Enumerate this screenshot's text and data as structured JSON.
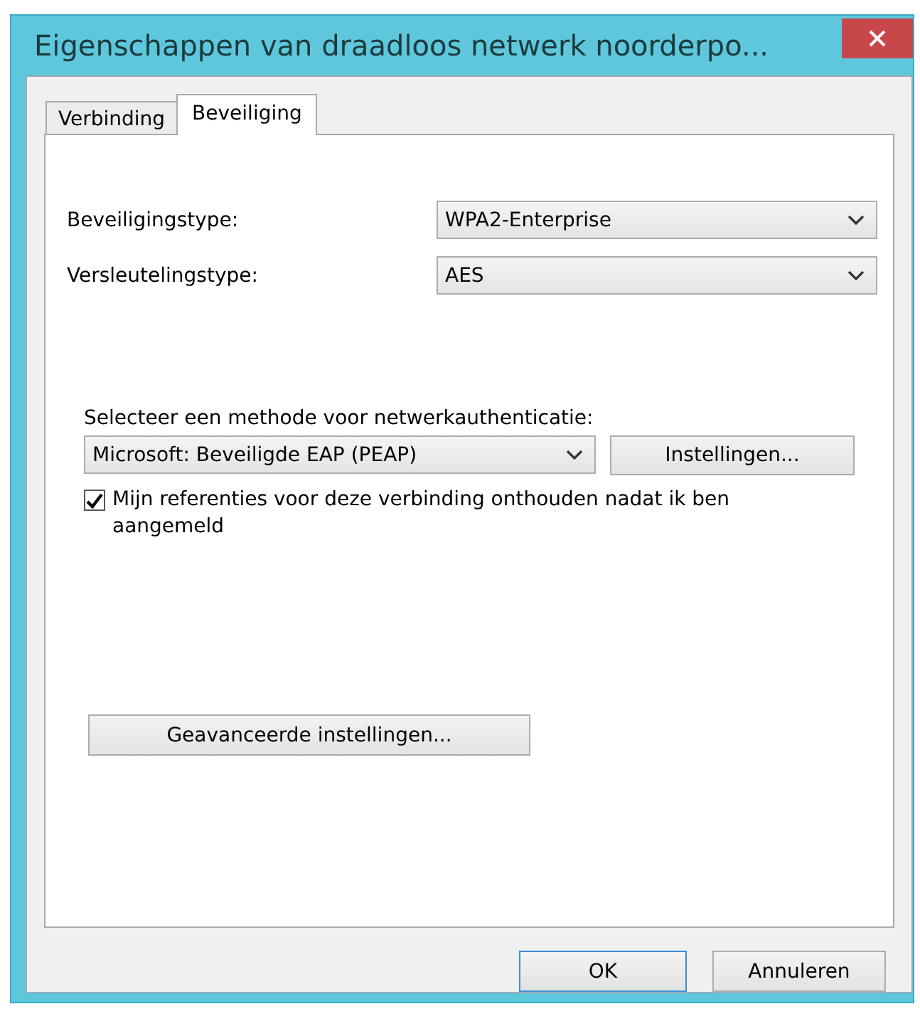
{
  "window": {
    "title": "Eigenschappen van draadloos netwerk noorderpo..."
  },
  "tabs": [
    {
      "label": "Verbinding",
      "selected": false
    },
    {
      "label": "Beveiliging",
      "selected": true
    }
  ],
  "security_type": {
    "label": "Beveiligingstype:",
    "value": "WPA2-Enterprise"
  },
  "encryption_type": {
    "label": "Versleutelingstype:",
    "value": "AES"
  },
  "auth_method": {
    "label": "Selecteer een methode voor netwerkauthenticatie:",
    "value": "Microsoft: Beveiligde EAP (PEAP)",
    "button": "Instellingen..."
  },
  "remember_credentials": {
    "label": "Mijn referenties voor deze verbinding onthouden nadat ik ben aangemeld",
    "checked": true
  },
  "advanced_button": "Geavanceerde instellingen...",
  "buttons": [
    {
      "label": "OK",
      "default": true
    },
    {
      "label": "Annuleren",
      "default": false
    }
  ]
}
